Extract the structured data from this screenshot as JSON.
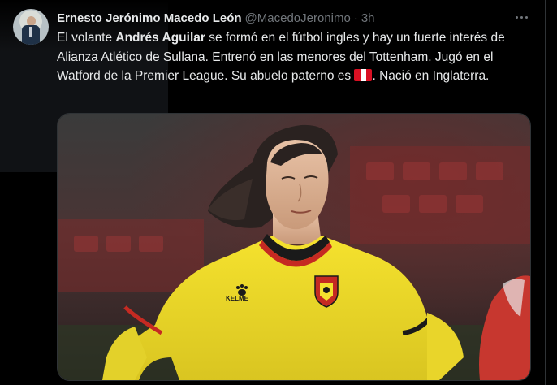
{
  "tweet": {
    "author_name": "Ernesto Jerónimo Macedo León",
    "author_handle": "@MacedoJeronimo",
    "separator": "·",
    "time": "3h",
    "text_parts": {
      "p1": "El volante ",
      "p2_bold": "Andrés Aguilar",
      "p3": " se formó en el fútbol ingles y hay un fuerte interés de Alianza Atlético de Sullana. Entrenó en las menores del Tottenham. Jugó en el Watford de la Premier League. Su abuelo paterno es ",
      "flag": "peru-flag-emoji",
      "p4": ". Nació en Inglaterra."
    },
    "media": {
      "kit_brand_text": "KELME",
      "icons": [
        "more-options-icon",
        "kelme-paw-logo",
        "watford-crest-icon",
        "peru-flag-emoji"
      ]
    }
  },
  "colors": {
    "background": "#000000",
    "text_primary": "#e7e9ea",
    "text_secondary": "#71767b",
    "border": "#2f3336",
    "jersey_yellow": "#f2df2a",
    "jersey_red": "#c52a22",
    "peru_red": "#d91023"
  }
}
